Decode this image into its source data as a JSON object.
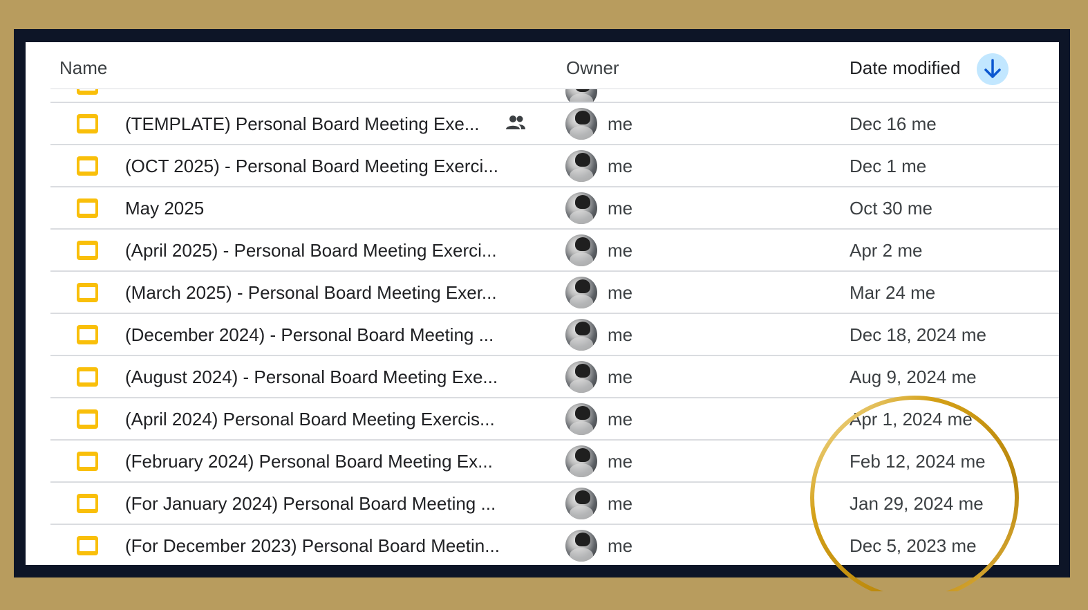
{
  "header": {
    "name_label": "Name",
    "owner_label": "Owner",
    "date_label": "Date modified",
    "sort_direction": "descending"
  },
  "files": [
    {
      "name": "(TEMPLATE) Personal Board Meeting Exe...",
      "shared": true,
      "owner": "me",
      "modified": "Dec 16 me"
    },
    {
      "name": "(OCT 2025) - Personal Board Meeting Exerci...",
      "shared": false,
      "owner": "me",
      "modified": "Dec 1 me"
    },
    {
      "name": "May 2025",
      "shared": false,
      "owner": "me",
      "modified": "Oct 30 me"
    },
    {
      "name": "(April 2025) - Personal Board Meeting Exerci...",
      "shared": false,
      "owner": "me",
      "modified": "Apr 2 me"
    },
    {
      "name": "(March 2025) - Personal Board Meeting Exer...",
      "shared": false,
      "owner": "me",
      "modified": "Mar 24 me"
    },
    {
      "name": "(December 2024) - Personal Board Meeting ...",
      "shared": false,
      "owner": "me",
      "modified": "Dec 18, 2024 me"
    },
    {
      "name": "(August 2024) - Personal Board Meeting Exe...",
      "shared": false,
      "owner": "me",
      "modified": "Aug 9, 2024 me"
    },
    {
      "name": "(April 2024) Personal Board Meeting Exercis...",
      "shared": false,
      "owner": "me",
      "modified": "Apr 1, 2024 me"
    },
    {
      "name": "(February 2024) Personal Board Meeting Ex...",
      "shared": false,
      "owner": "me",
      "modified": "Feb 12, 2024 me"
    },
    {
      "name": "(For January 2024) Personal Board Meeting ...",
      "shared": false,
      "owner": "me",
      "modified": "Jan 29, 2024 me"
    },
    {
      "name": "(For December 2023) Personal Board Meetin...",
      "shared": false,
      "owner": "me",
      "modified": "Dec 5, 2023 me"
    }
  ],
  "colors": {
    "background_gold": "#b89c5e",
    "frame_navy": "#0d1527",
    "doc_icon_yellow": "#f9bf0a",
    "sort_button_bg": "#c2e7ff",
    "sort_arrow": "#0b57d0",
    "highlight_ring": "#d4a017"
  },
  "icons": {
    "file_type": "slides-icon",
    "shared": "people-icon",
    "sort": "arrow-down-icon"
  }
}
